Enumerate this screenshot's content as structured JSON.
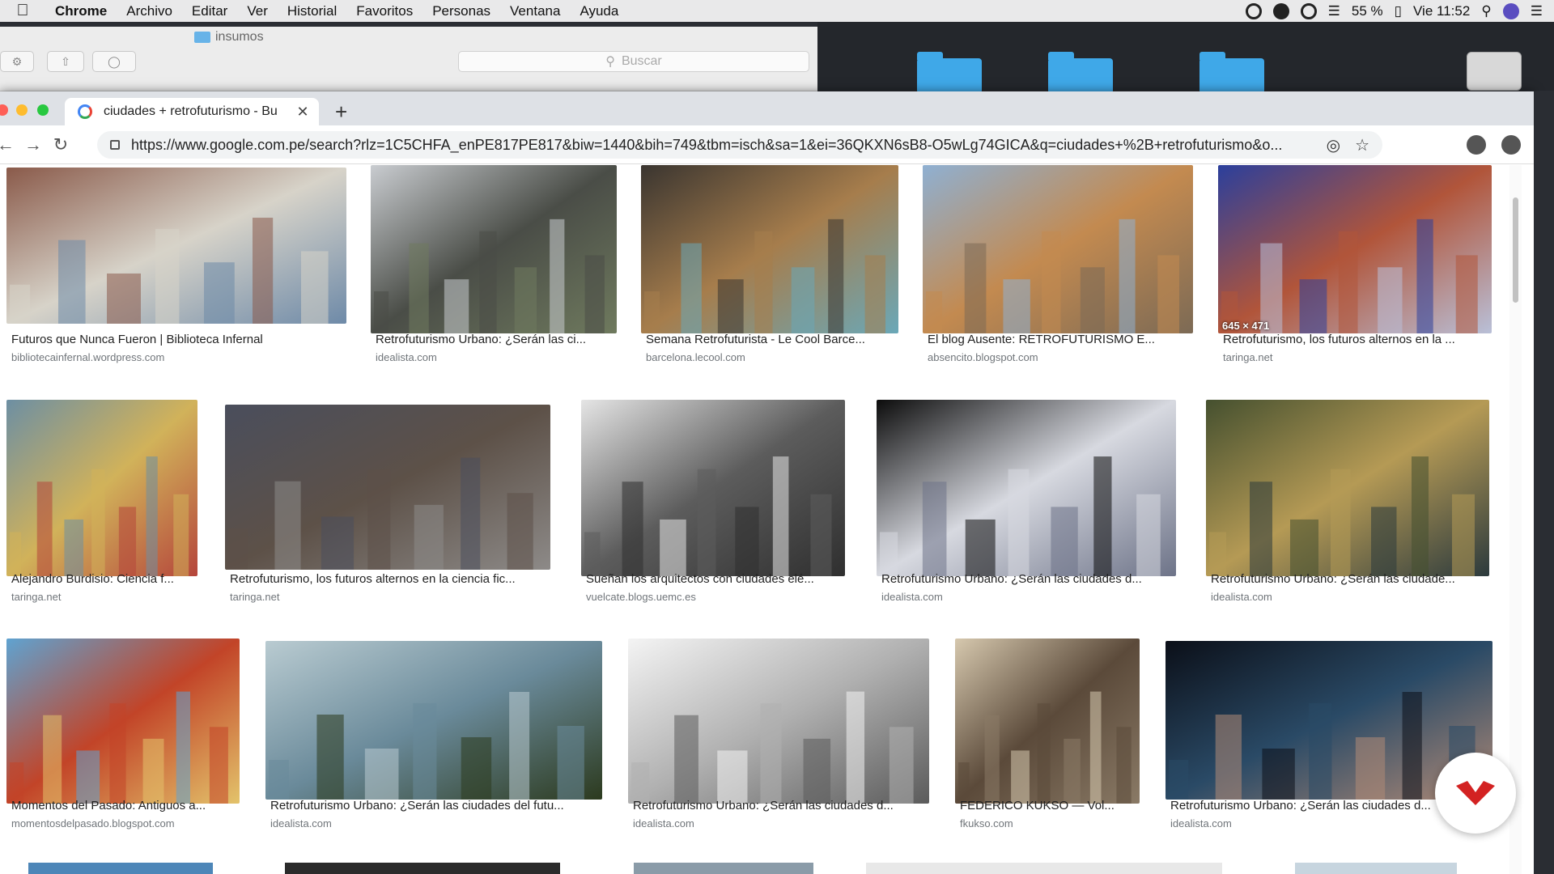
{
  "menubar": {
    "app": "Chrome",
    "items": [
      "Archivo",
      "Editar",
      "Ver",
      "Historial",
      "Favoritos",
      "Personas",
      "Ventana",
      "Ayuda"
    ],
    "battery": "55 %",
    "clock": "Vie 11:52"
  },
  "finder": {
    "title": "insumos",
    "search_placeholder": "Buscar"
  },
  "browser": {
    "tab_title": "ciudades + retrofuturismo - Bu",
    "url": "https://www.google.com.pe/search?rlz=1C5CHFA_enPE817PE817&biw=1440&bih=749&tbm=isch&sa=1&ei=36QKXN6sB8-O5wLg74GICA&q=ciudades+%2B+retrofuturismo&o..."
  },
  "results": [
    [
      {
        "title": "Futuros que Nunca Fueron | Biblioteca Infernal",
        "source": "bibliotecainfernal.wordpress.com",
        "colors": [
          "#8a5a4a",
          "#d7d3c9",
          "#6e8aa8"
        ]
      },
      {
        "title": "Retrofuturismo Urbano: ¿Serán las ci...",
        "source": "idealista.com",
        "colors": [
          "#c9ccd0",
          "#4a4d47",
          "#6f7a5e"
        ]
      },
      {
        "title": "Semana Retrofuturista - Le Cool Barce...",
        "source": "barcelona.lecool.com",
        "colors": [
          "#3a3530",
          "#a67d4c",
          "#6aa8b8"
        ]
      },
      {
        "title": "El blog Ausente: RETROFUTURISMO E...",
        "source": "absencito.blogspot.com",
        "colors": [
          "#8fb0d2",
          "#c38a50",
          "#7c6a55"
        ]
      },
      {
        "title": "Retrofuturismo, los futuros alternos en la ...",
        "source": "taringa.net",
        "dims": "645 × 471",
        "colors": [
          "#2b3f9c",
          "#b1553a",
          "#b9c0d8"
        ]
      }
    ],
    [
      {
        "title": "Alejandro Burdisio: Ciencia f...",
        "source": "taringa.net",
        "colors": [
          "#6d8fa3",
          "#d1b25a",
          "#b5453b"
        ]
      },
      {
        "title": "Retrofuturismo, los futuros alternos en la ciencia fic...",
        "source": "taringa.net",
        "colors": [
          "#4a4e5c",
          "#5d5148",
          "#8d8a88"
        ]
      },
      {
        "title": "Sueñan los arquitectos con ciudades elé...",
        "source": "vuelcate.blogs.uemc.es",
        "colors": [
          "#e5e5e5",
          "#5c5c5c",
          "#2f2f2f"
        ]
      },
      {
        "title": "Retrofuturismo Urbano: ¿Serán las ciudades d...",
        "source": "idealista.com",
        "colors": [
          "#0c0c0c",
          "#d7d9e0",
          "#6d7388"
        ]
      },
      {
        "title": "Retrofuturismo Urbano: ¿Serán las ciudade...",
        "source": "idealista.com",
        "colors": [
          "#45502f",
          "#b59a55",
          "#2c3a3d"
        ]
      }
    ],
    [
      {
        "title": "Momentos del Pasado: Antiguos a...",
        "source": "momentosdelpasado.blogspot.com",
        "colors": [
          "#5fa3d1",
          "#c24428",
          "#e3c36b"
        ]
      },
      {
        "title": "Retrofuturismo Urbano: ¿Serán las ciudades del futu...",
        "source": "idealista.com",
        "colors": [
          "#b9cbd1",
          "#6a8a9a",
          "#2c3a1e"
        ]
      },
      {
        "title": "Retrofuturismo Urbano: ¿Serán las ciudades d...",
        "source": "idealista.com",
        "colors": [
          "#f4f4f4",
          "#b0b0b0",
          "#5b5b5b"
        ]
      },
      {
        "title": "FEDERICO KUKSO — Vol...",
        "source": "fkukso.com",
        "colors": [
          "#d6c8ae",
          "#5b4a3a",
          "#8a7a66"
        ]
      },
      {
        "title": "Retrofuturismo Urbano: ¿Serán las ciudades d...",
        "source": "idealista.com",
        "colors": [
          "#0b0f18",
          "#2a4a66",
          "#b08a76"
        ]
      }
    ]
  ],
  "bottom_row_colors": [
    "#4d86b8",
    "#2b2b2b",
    "#8a9ba8",
    "#e8e8e8",
    "#c7d5df"
  ]
}
